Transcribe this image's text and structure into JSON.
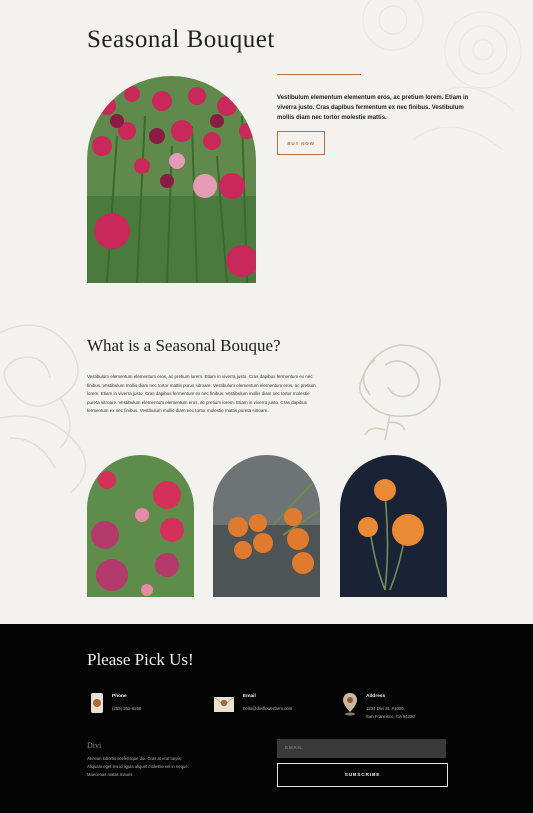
{
  "hero": {
    "title": "Seasonal Bouquet",
    "intro": "Vestibulum elementum elementum eros, ac pretium lorem. Etiam in viverra justo. Cras dapibus fermentum ex nec finibus. Vestibulum mollis diam nec tortor molestie mattis.",
    "button_label": "BUY NOW"
  },
  "about": {
    "title": "What is a Seasonal Bouque?",
    "body": "Vestibulum elementum elementum eros, ac pretium lorem. Etiam in viverra justo. Cras dapibus fermentum ex nec finibus. Vestibulum mollis diam nec tortor mattis purus sitroare. Vestibulum elementum elementum eros, ac pretium lorem. Etiam in viverra justo. Cras dapibus fermentum ex nec finibus. Vestibulum mollis diam nec tortor molestie pureta sitroare. Vestibulum elementum elementum eros, ac pretium lorem. Etiam in viverra justo. Cras dapibus fermentum ex nec finibus. Vestibulum mollic diam nec tortor molestie mattis pureta sitroare."
  },
  "footer": {
    "title": "Please Pick Us!",
    "phone": {
      "label": "Phone",
      "value": "(255) 352-6258"
    },
    "email": {
      "label": "Email",
      "value": "hello@diviflowerfarm.com"
    },
    "address": {
      "label": "Address",
      "line1": "1234 Divi St. #1000,",
      "line2": "San Francisco, CA 94220"
    },
    "brand": "Divi",
    "brand_text": "Aenean lobortis scelerisque dui. Cras at erat turpis. Aliquam eget leo id ligula aliquet molestie vel in neque. Maecenas mattis mauris.",
    "email_placeholder": "EMAIL",
    "subscribe_label": "SUBSCRIBE"
  },
  "colors": {
    "accent": "#b8703e",
    "background": "#f4f2ee",
    "footer": "#040404"
  }
}
